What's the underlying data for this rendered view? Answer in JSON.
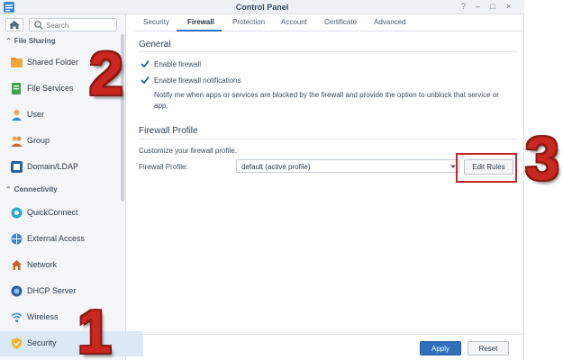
{
  "window": {
    "title": "Control Panel",
    "controls": [
      "?",
      "–",
      "□",
      "×"
    ]
  },
  "sidebar": {
    "search_placeholder": "Search",
    "sections": [
      {
        "label": "File Sharing"
      },
      {
        "label": "Connectivity"
      }
    ],
    "items": [
      {
        "label": "Shared Folder",
        "icon": "shared-folder-icon"
      },
      {
        "label": "File Services",
        "icon": "file-services-icon"
      },
      {
        "label": "User",
        "icon": "user-icon"
      },
      {
        "label": "Group",
        "icon": "group-icon"
      },
      {
        "label": "Domain/LDAP",
        "icon": "domain-ldap-icon"
      },
      {
        "label": "QuickConnect",
        "icon": "quickconnect-icon"
      },
      {
        "label": "External Access",
        "icon": "external-access-icon"
      },
      {
        "label": "Network",
        "icon": "network-icon"
      },
      {
        "label": "DHCP Server",
        "icon": "dhcp-server-icon"
      },
      {
        "label": "Wireless",
        "icon": "wireless-icon"
      },
      {
        "label": "Security",
        "icon": "security-shield-icon",
        "active": true
      }
    ]
  },
  "tabs": [
    {
      "label": "Security"
    },
    {
      "label": "Firewall",
      "active": true
    },
    {
      "label": "Protection"
    },
    {
      "label": "Account"
    },
    {
      "label": "Certificate"
    },
    {
      "label": "Advanced"
    }
  ],
  "general": {
    "heading": "General",
    "enable_firewall": {
      "label": "Enable firewall",
      "checked": true
    },
    "enable_notifications": {
      "label": "Enable firewall notifications",
      "checked": true
    },
    "notify_line1": "Notify me when apps or services are blocked by the firewall and provide the option to unblock that service or",
    "notify_line2": "app."
  },
  "profile": {
    "heading": "Firewall Profile",
    "description": "Customize your firewall profile.",
    "field_label": "Firewall Profile:",
    "selected_value": "default (active profile)",
    "edit_button": "Edit Rules"
  },
  "footer": {
    "apply_label": "Apply",
    "reset_label": "Reset"
  },
  "annotations": {
    "step1": "1",
    "step2": "2",
    "step3": "3"
  },
  "colors": {
    "accent": "#2f6fbc",
    "annotation_red": "#c9271f",
    "active_row": "#dbe8f6"
  }
}
